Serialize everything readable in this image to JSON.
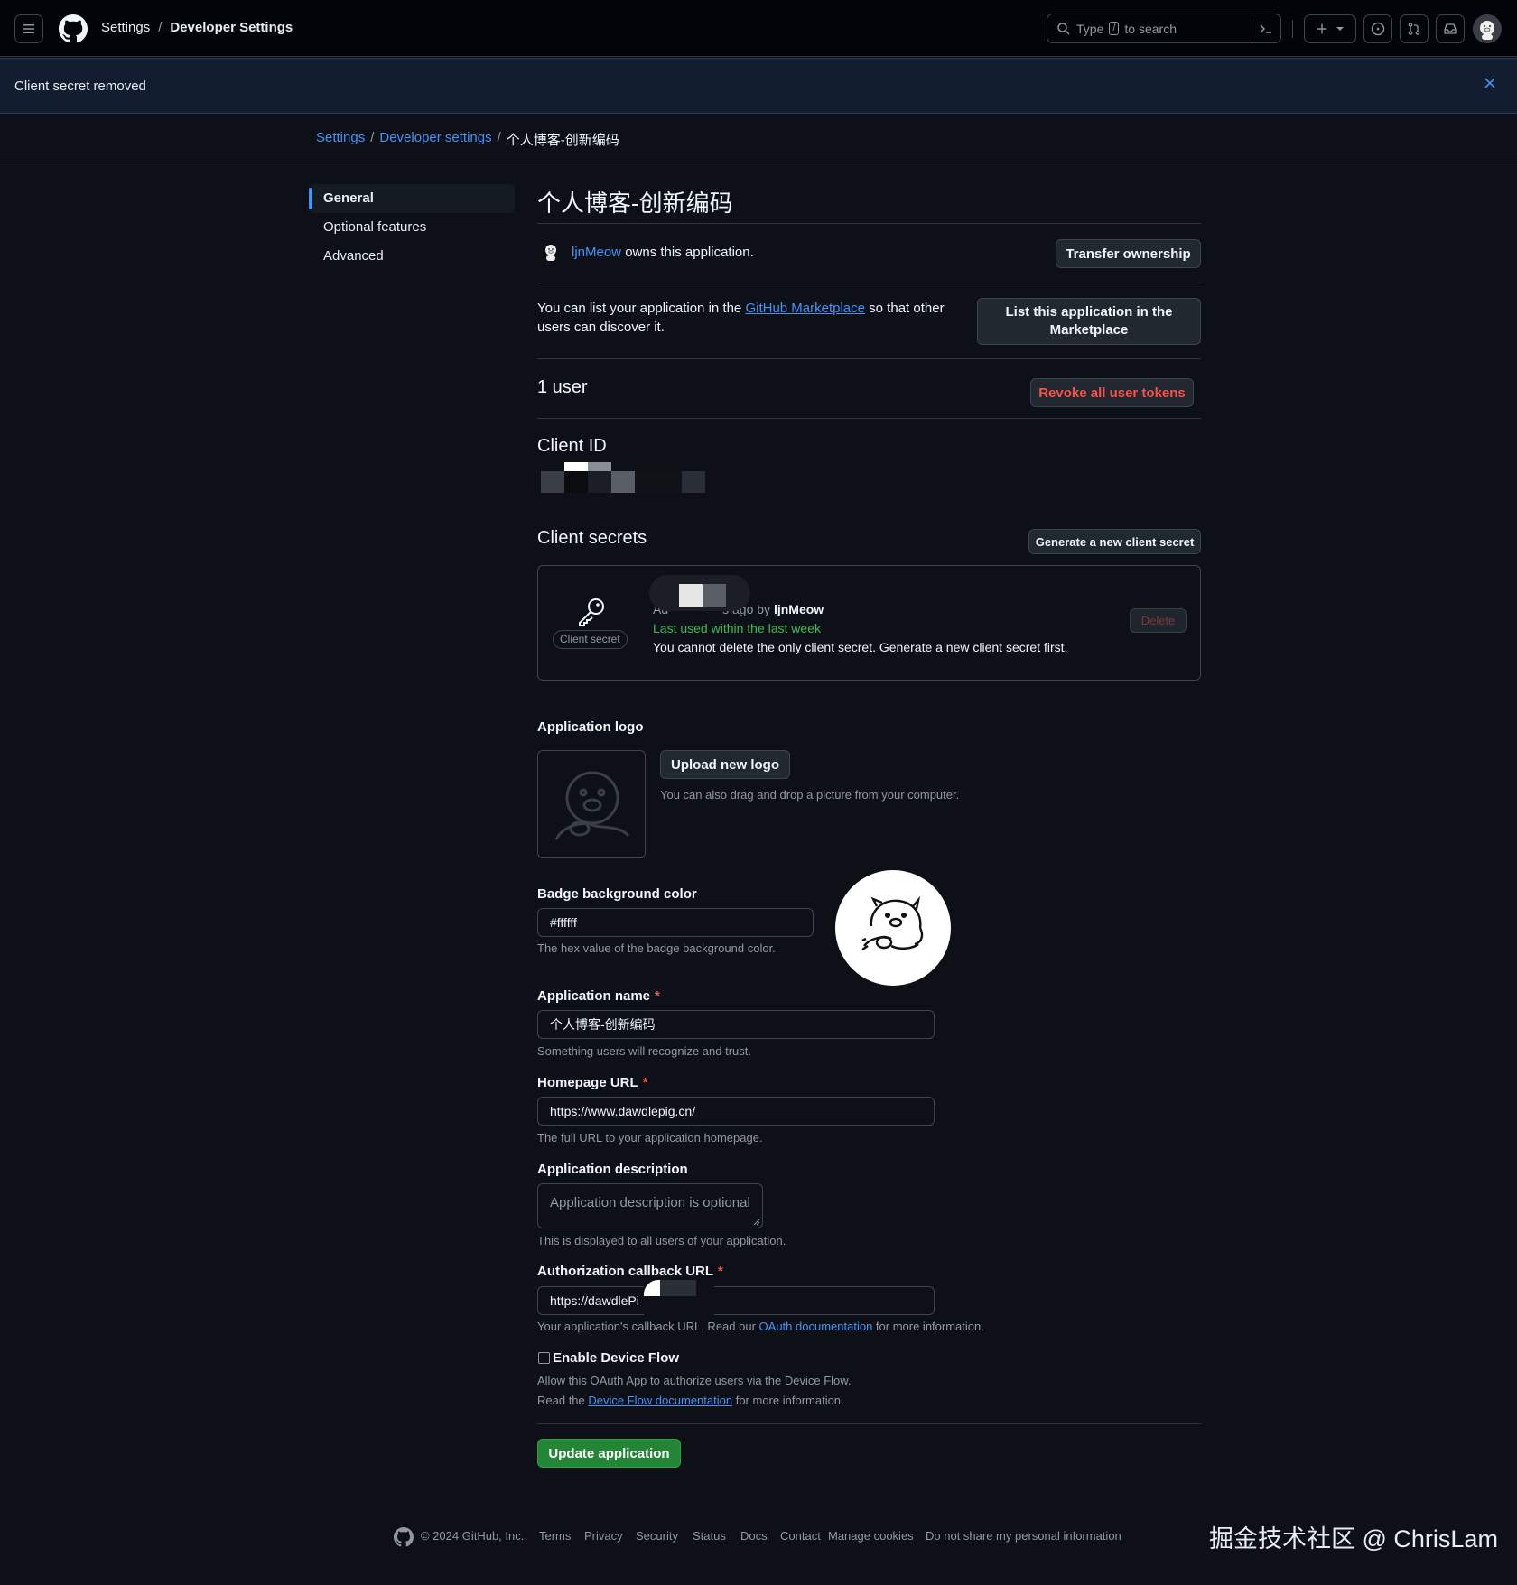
{
  "header": {
    "settings": "Settings",
    "separator": "/",
    "developer_settings": "Developer Settings",
    "search_type": "Type",
    "search_key": "/",
    "search_rest": "to search"
  },
  "flash": {
    "message": "Client secret removed"
  },
  "breadcrumb": {
    "items": [
      "Settings",
      "Developer settings",
      "个人博客-创新编码"
    ],
    "separator": "/"
  },
  "sidebar": {
    "items": [
      "General",
      "Optional features",
      "Advanced"
    ]
  },
  "app": {
    "title": "个人博客-创新编码",
    "owner": "ljnMeow",
    "owns_text": "owns this application.",
    "transfer_button": "Transfer ownership"
  },
  "marketplace": {
    "text_before": "You can list your application in the",
    "link": "GitHub Marketplace",
    "text_after": "so that other users can discover it.",
    "button": "List this application in the Marketplace"
  },
  "users": {
    "count_text": "1 user",
    "revoke_button": "Revoke all user tokens"
  },
  "client_id": {
    "heading": "Client ID"
  },
  "client_secrets": {
    "heading": "Client secrets",
    "generate_button": "Generate a new client secret",
    "badge": "Client secret",
    "added_prefix": "Ad",
    "added_suffix": "s ago by",
    "added_by": "ljnMeow",
    "last_used": "Last used within the last week",
    "warning": "You cannot delete the only client secret. Generate a new client secret first.",
    "delete_button": "Delete"
  },
  "logo": {
    "heading": "Application logo",
    "upload_button": "Upload new logo",
    "drag_note": "You can also drag and drop a picture from your computer."
  },
  "badge_color": {
    "label": "Badge background color",
    "value": "#ffffff",
    "note": "The hex value of the badge background color."
  },
  "app_name": {
    "label": "Application name",
    "required": "*",
    "value": "个人博客-创新编码",
    "note": "Something users will recognize and trust."
  },
  "homepage": {
    "label": "Homepage URL",
    "required": "*",
    "value": "https://www.dawdlepig.cn/",
    "note": "The full URL to your application homepage."
  },
  "description": {
    "label": "Application description",
    "placeholder": "Application description is optional",
    "note": "This is displayed to all users of your application."
  },
  "callback": {
    "label": "Authorization callback URL",
    "required": "*",
    "value": "https://dawdlePi",
    "note_before": "Your application's callback URL. Read our",
    "note_link": "OAuth documentation",
    "note_after": "for more information."
  },
  "device_flow": {
    "label": "Enable Device Flow",
    "note1": "Allow this OAuth App to authorize users via the Device Flow.",
    "note2_before": "Read the",
    "note2_link": "Device Flow documentation",
    "note2_after": "for more information."
  },
  "update_button": "Update application",
  "footer": {
    "copyright": "© 2024 GitHub, Inc.",
    "links": [
      "Terms",
      "Privacy",
      "Security",
      "Status",
      "Docs",
      "Contact",
      "Manage cookies",
      "Do not share my personal information"
    ]
  },
  "watermark": "掘金技术社区 @ ChrisLam",
  "colors": {
    "background": "#0d1117",
    "header": "#010409",
    "accent": "#4493f8",
    "danger": "#f85149",
    "success": "#238636",
    "success_text": "#3fb950"
  }
}
